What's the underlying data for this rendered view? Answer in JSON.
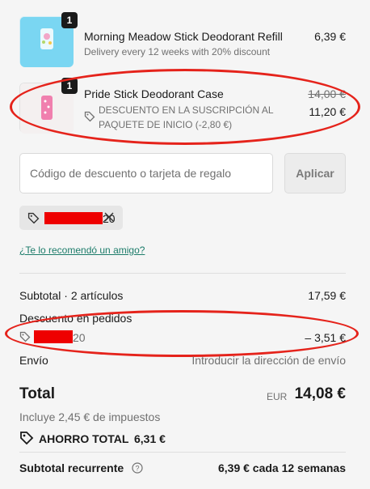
{
  "items": [
    {
      "quantity": "1",
      "title": "Morning Meadow Stick Deodorant Refill",
      "subtitle": "Delivery every 12 weeks with 20% discount",
      "price": "6,39 €"
    },
    {
      "quantity": "1",
      "title": "Pride Stick Deodorant Case",
      "discount_line1": "DESCUENTO EN LA SUSCRIPCIÓN AL",
      "discount_line2": "PAQUETE DE INICIO (-2,80 €)",
      "original_price": "14,00 €",
      "price": "11,20 €"
    }
  ],
  "discount": {
    "placeholder": "Código de descuento o tarjeta de regalo",
    "apply_label": "Aplicar",
    "applied_code_suffix": "20",
    "referral_link": "¿Te lo recomendó un amigo?"
  },
  "summary": {
    "subtotal_label": "Subtotal · 2 artículos",
    "subtotal_value": "17,59 €",
    "order_discount_label": "Descuento en pedidos",
    "order_discount_code_suffix": "20",
    "order_discount_value": "– 3,51 €",
    "shipping_label": "Envío",
    "shipping_value": "Introducir la dirección de envío",
    "total_label": "Total",
    "currency": "EUR",
    "total_value": "14,08 €",
    "taxes_note": "Incluye 2,45 € de impuestos",
    "savings_label": "AHORRO TOTAL",
    "savings_value": "6,31 €",
    "recurring_label": "Subtotal recurrente",
    "recurring_value": "6,39 € cada 12 semanas"
  },
  "colors": {
    "annotation": "#e5231b",
    "redaction": "#ee0000",
    "link": "#1c7c6a"
  }
}
